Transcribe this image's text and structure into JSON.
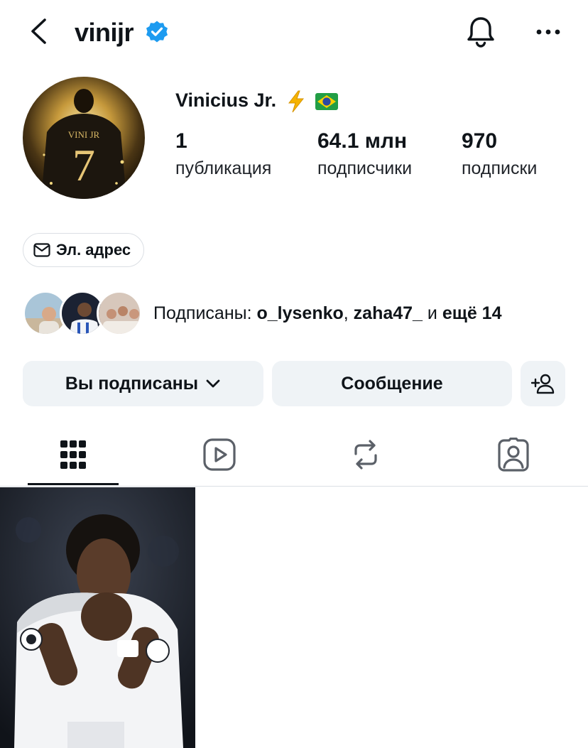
{
  "header": {
    "username": "vinijr",
    "verified": true,
    "icons": [
      "back-arrow-icon",
      "verified-badge-icon",
      "bell-icon",
      "more-horizontal-icon"
    ]
  },
  "profile": {
    "full_name": "Vinicius Jr.",
    "name_emojis": [
      "lightning-icon",
      "brazil-flag-icon"
    ],
    "avatar_jersey_text": "VINI JR",
    "avatar_jersey_number": "7",
    "stats": [
      {
        "value": "1",
        "label": "публикация"
      },
      {
        "value": "64.1 млн",
        "label": "подписчики"
      },
      {
        "value": "970",
        "label": "подписки"
      }
    ],
    "email_button_label": "Эл. адрес"
  },
  "followed_by": {
    "prefix": "Подписаны: ",
    "user1": "o_lysenko",
    "separator": ", ",
    "user2": "zaha47_",
    "conjunction": " и ",
    "more": "ещё 14"
  },
  "actions": {
    "following_label": "Вы подписаны",
    "message_label": "Сообщение"
  },
  "tabs": [
    {
      "name": "grid",
      "icon": "grid-icon",
      "active": true
    },
    {
      "name": "reels",
      "icon": "reels-icon",
      "active": false
    },
    {
      "name": "reposts",
      "icon": "repost-icon",
      "active": false
    },
    {
      "name": "tagged",
      "icon": "tagged-person-icon",
      "active": false
    }
  ],
  "colors": {
    "text": "#0f1419",
    "verified_blue": "#1d9bf0",
    "button_bg": "#eff3f6",
    "border": "#dbdfe4"
  }
}
